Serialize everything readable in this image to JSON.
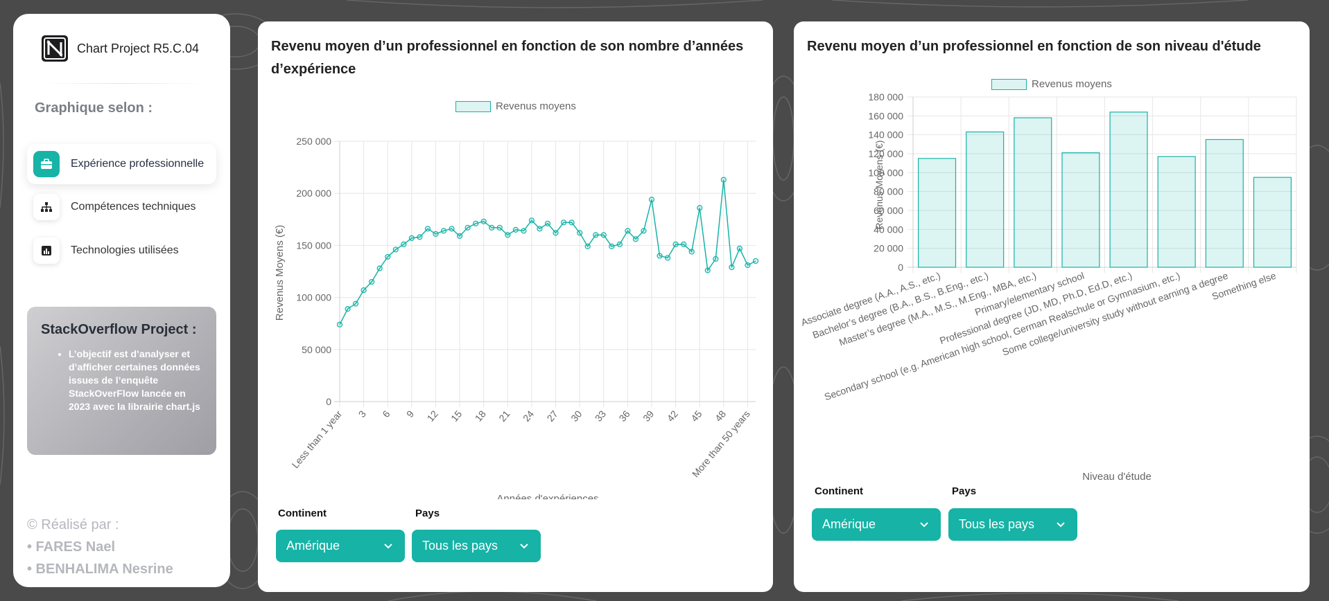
{
  "sidebar": {
    "brand": "Chart Project R5.C.04",
    "section_title": "Graphique selon :",
    "nav": [
      {
        "label": "Expérience professionnelle",
        "icon": "briefcase-icon",
        "active": true
      },
      {
        "label": "Compétences techniques",
        "icon": "sitemap-icon",
        "active": false
      },
      {
        "label": "Technologies utilisées",
        "icon": "bar-chart-icon",
        "active": false
      }
    ],
    "info": {
      "title": "StackOverflow Project :",
      "text": "L’objectif est d’analyser et d’afficher certaines données issues de l’enquête StackOverFlow lancée en 2023 avec la librairie chart.js"
    },
    "credits": {
      "intro": "© Réalisé par :",
      "authors": [
        "• FARES Nael",
        "• BENHALIMA Nesrine"
      ]
    }
  },
  "colors": {
    "accent": "#16b3a6",
    "fill": "rgba(22,179,166,0.15)"
  },
  "card1": {
    "title": "Revenu moyen d’un professionnel en fonction de son nombre d’années d’expérience",
    "filters": {
      "continent_label": "Continent",
      "continent_value": "Amérique",
      "pays_label": "Pays",
      "pays_value": "Tous les pays"
    }
  },
  "card2": {
    "title": "Revenu moyen d’un professionnel en fonction de son niveau d'étude",
    "filters": {
      "continent_label": "Continent",
      "continent_value": "Amérique",
      "pays_label": "Pays",
      "pays_value": "Tous les pays"
    }
  },
  "chart_data": [
    {
      "type": "line",
      "legend": "Revenus moyens",
      "xlabel": "Années d'expériences",
      "ylabel": "Revenus Moyens (€)",
      "ylim": [
        0,
        250000
      ],
      "yticks": [
        "0",
        "50 000",
        "100 000",
        "150 000",
        "200 000",
        "250 000"
      ],
      "xtick_labels": [
        "Less than 1 year",
        "3",
        "6",
        "9",
        "12",
        "15",
        "18",
        "21",
        "24",
        "27",
        "30",
        "33",
        "36",
        "39",
        "42",
        "45",
        "48",
        "More than 50 years"
      ],
      "x": [
        "Less than 1 year",
        "1",
        "2",
        "3",
        "4",
        "5",
        "6",
        "7",
        "8",
        "9",
        "10",
        "11",
        "12",
        "13",
        "14",
        "15",
        "16",
        "17",
        "18",
        "19",
        "20",
        "21",
        "22",
        "23",
        "24",
        "25",
        "26",
        "27",
        "28",
        "29",
        "30",
        "31",
        "32",
        "33",
        "34",
        "35",
        "36",
        "37",
        "38",
        "39",
        "40",
        "41",
        "42",
        "43",
        "44",
        "45",
        "46",
        "47",
        "48",
        "49",
        "50",
        "More than 50 years"
      ],
      "values": [
        74000,
        89000,
        94000,
        107000,
        115000,
        128000,
        139000,
        146000,
        151000,
        157000,
        158000,
        166000,
        161000,
        164000,
        166000,
        159000,
        167000,
        171000,
        173000,
        167000,
        167000,
        160000,
        165000,
        164000,
        174000,
        166000,
        171000,
        162000,
        172000,
        172000,
        162000,
        149000,
        160000,
        160000,
        149000,
        151000,
        164000,
        156000,
        164000,
        194000,
        140000,
        138000,
        151000,
        151000,
        144000,
        186000,
        126000,
        137000,
        213000,
        129000,
        147000,
        131000,
        135000
      ]
    },
    {
      "type": "bar",
      "legend": "Revenus moyens",
      "xlabel": "Niveau d'étude",
      "ylabel": "Revenus Moyens (€)",
      "ylim": [
        0,
        180000
      ],
      "yticks": [
        "0",
        "20 000",
        "40 000",
        "60 000",
        "80 000",
        "100 000",
        "120 000",
        "140 000",
        "160 000",
        "180 000"
      ],
      "categories": [
        "Associate degree (A.A., A.S., etc.)",
        "Bachelor’s degree (B.A., B.S., B.Eng., etc.)",
        "Master’s degree (M.A., M.S., M.Eng., MBA, etc.)",
        "Primary/elementary school",
        "Professional degree (JD, MD, Ph.D, Ed.D, etc.)",
        "Secondary school (e.g. American high school, German Realschule or Gymnasium, etc.)",
        "Some college/university study without earning a degree",
        "Something else"
      ],
      "values": [
        115000,
        143000,
        158000,
        121000,
        164000,
        117000,
        135000,
        95000
      ]
    }
  ]
}
